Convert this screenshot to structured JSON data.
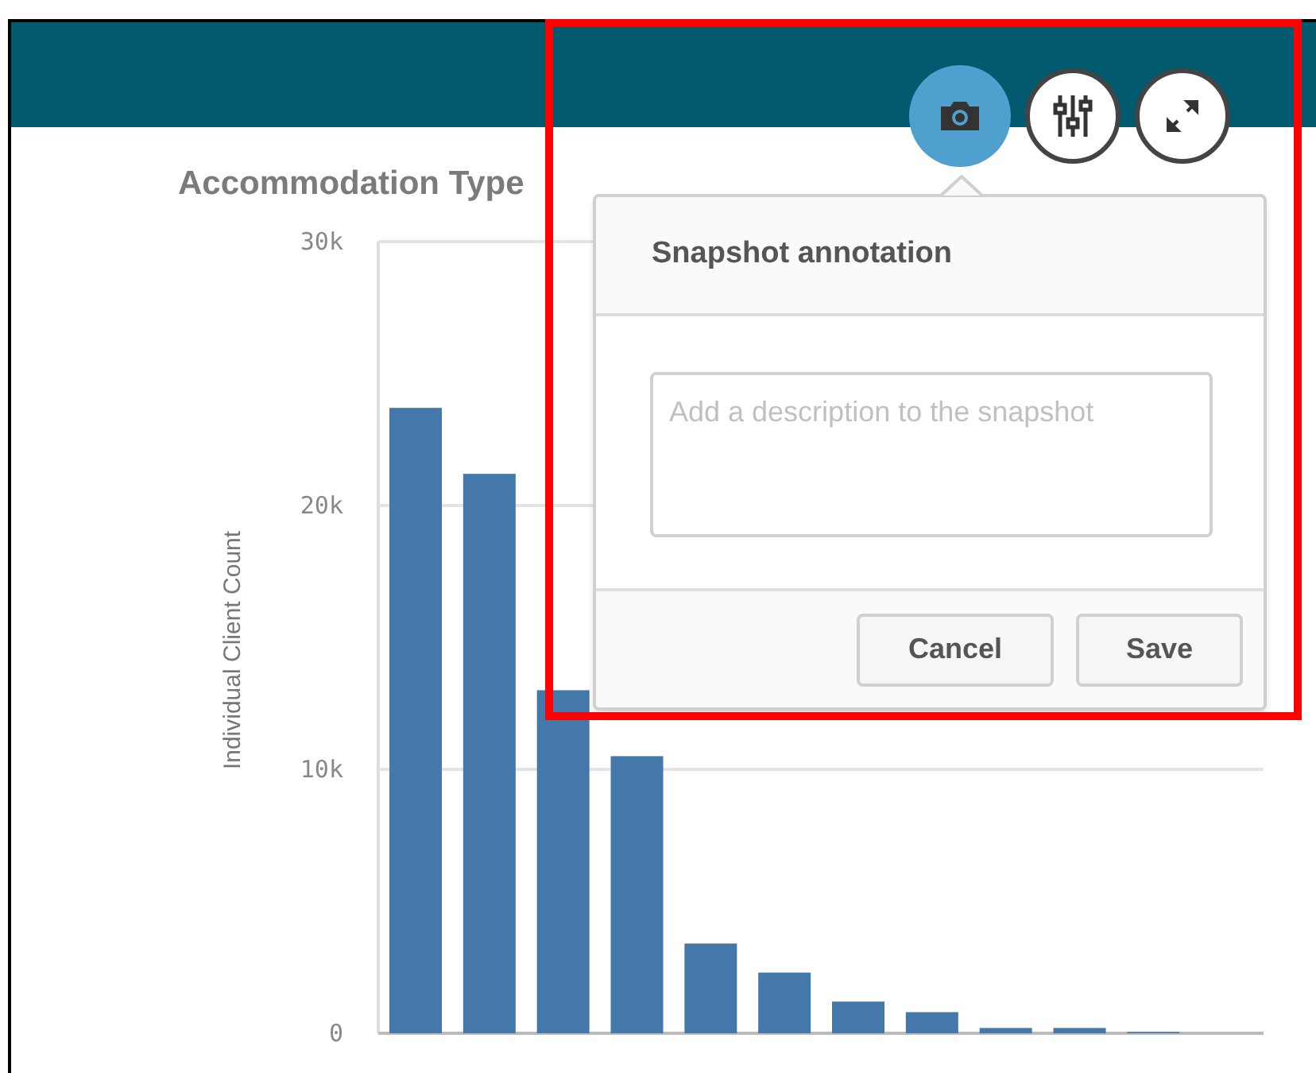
{
  "toolbar": [
    {
      "kind": "camera",
      "selected": true
    },
    {
      "kind": "sliders",
      "selected": false
    },
    {
      "kind": "expand",
      "selected": false
    }
  ],
  "chart_data": {
    "type": "bar",
    "title": "Accommodation Type",
    "ylabel": "Individual Client Count",
    "values": [
      23700,
      21200,
      13000,
      10500,
      3400,
      2300,
      1200,
      800,
      200,
      200,
      50,
      0
    ],
    "ylim": [
      0,
      30000
    ],
    "yticks": [
      {
        "value": 0,
        "label": "0"
      },
      {
        "value": 10000,
        "label": "10k"
      },
      {
        "value": 20000,
        "label": "20k"
      },
      {
        "value": 30000,
        "label": "30k"
      }
    ]
  },
  "popup": {
    "title": "Snapshot annotation",
    "field": {
      "placeholder": "Add a description to the snapshot"
    },
    "buttons": [
      "Cancel",
      "Save"
    ]
  }
}
